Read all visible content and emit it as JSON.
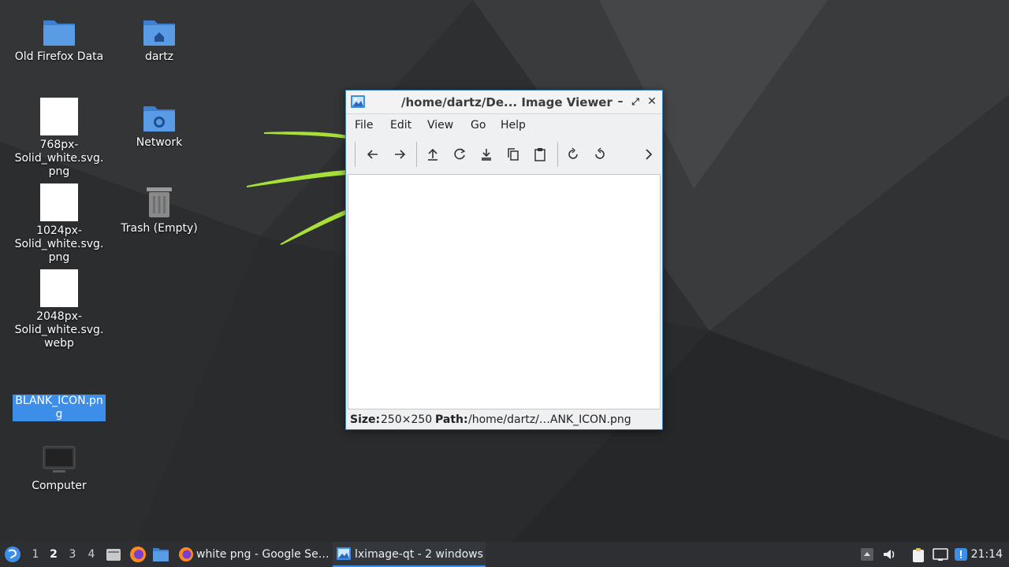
{
  "desktop": {
    "icons": [
      {
        "label": "Old Firefox Data",
        "icon": "folder-icon"
      },
      {
        "label": "dartz",
        "icon": "home-folder-icon"
      },
      {
        "label": "768px-Solid_white.svg.png",
        "icon": "image-file-icon"
      },
      {
        "label": "Network",
        "icon": "network-folder-icon"
      },
      {
        "label": "1024px-Solid_white.svg.png",
        "icon": "image-file-icon"
      },
      {
        "label": "Trash (Empty)",
        "icon": "trash-icon"
      },
      {
        "label": "2048px-Solid_white.svg.webp",
        "icon": "image-file-icon"
      },
      {
        "label": "BLANK_ICON.png",
        "icon": "image-file-icon",
        "selected": true
      },
      {
        "label": "Computer",
        "icon": "computer-icon"
      }
    ]
  },
  "viewer": {
    "title": "/home/dartz/De... Image Viewer",
    "menu": [
      "File",
      "Edit",
      "View",
      "Go",
      "Help"
    ],
    "toolbar": [
      "previous-icon",
      "next-icon",
      "upload-icon",
      "reload-icon",
      "save-icon",
      "copy-icon",
      "paste-icon",
      "rotate-clockwise-icon",
      "rotate-counterclockwise-icon",
      "more-icon"
    ],
    "status": {
      "size_label": "Size:",
      "size_value": "250×250",
      "path_label": "Path:",
      "path_value": "/home/dartz/…ANK_ICON.png"
    }
  },
  "taskbar": {
    "workspaces": [
      "1",
      "2",
      "3",
      "4"
    ],
    "active_workspace": "2",
    "tasks": [
      {
        "label": "white png - Google Se…",
        "icon": "firefox-icon"
      },
      {
        "label": "lximage-qt - 2 windows",
        "icon": "image-viewer-icon",
        "active": true
      }
    ],
    "clock": "21:14"
  },
  "colors": {
    "accent": "#3d8ee8",
    "wallpaper_dark": "#2b2c2e",
    "wallpaper_stripe": "#a8e03a"
  }
}
